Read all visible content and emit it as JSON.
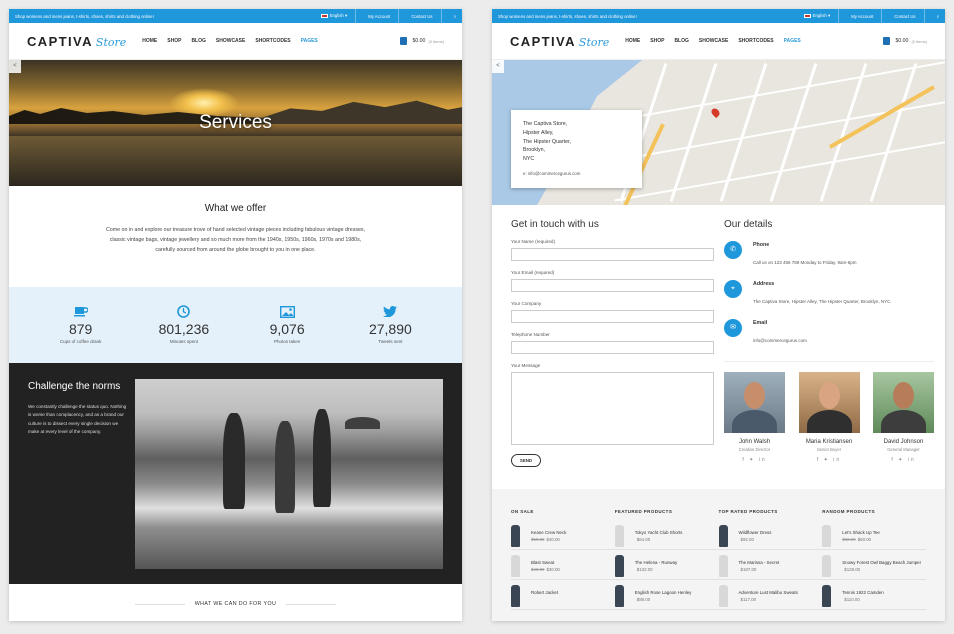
{
  "topbar": {
    "promo": "Shop womens and mens jeans, t-shirts, shoes, shirts and clothing online!",
    "language": "English",
    "account": "My Account",
    "contact": "Contact Us"
  },
  "header": {
    "logo_main": "CAPTIVA",
    "logo_script": "Store",
    "nav": [
      "HOME",
      "SHOP",
      "BLOG",
      "SHOWCASE",
      "SHORTCODES",
      "PAGES"
    ],
    "cart_total": "$0.00",
    "cart_items": "(0 items)"
  },
  "services": {
    "hero_title": "Services",
    "offer_title": "What we offer",
    "offer_text": "Come on in and explore our treasure trove of hand selected vintage pieces including fabulous vintage dresses, classic vintage bags, vintage jewellery and so much more from the 1940s, 1950s, 1960s, 1970s and 1980s, carefully sourced from around the globe brought to you in one place.",
    "stats": [
      {
        "icon": "coffee-icon",
        "value": "879",
        "label": "Cups of coffee drank"
      },
      {
        "icon": "clock-icon",
        "value": "801,236",
        "label": "Minutes spent"
      },
      {
        "icon": "photo-icon",
        "value": "9,076",
        "label": "Photos taken"
      },
      {
        "icon": "twitter-icon",
        "value": "27,890",
        "label": "Tweets sent"
      }
    ],
    "challenge_title": "Challenge the norms",
    "challenge_text": "We constantly challenge the status quo. Nothing is worse than complacency, and as a brand our culture is to dissect every single decision we make at every level of the company.",
    "what_we_can_do": "WHAT WE CAN DO FOR YOU"
  },
  "contact": {
    "address_lines": [
      "The Captiva Store,",
      "Hipster Alley,",
      "The Hipster Quarter,",
      "Brooklyn,",
      "NYC"
    ],
    "address_email": "e: info@commercegurus.com",
    "form_title": "Get in touch with us",
    "fields": [
      "Your Name (required)",
      "Your Email (required)",
      "Your Company",
      "Telephone Number"
    ],
    "message_label": "Your Message",
    "send_label": "SEND",
    "details_title": "Our details",
    "details": [
      {
        "icon": "phone-icon",
        "glyph": "✆",
        "title": "Phone",
        "text": "Call us on 123 456 789 Monday to Friday, 9am-6pm"
      },
      {
        "icon": "location-icon",
        "glyph": "⌖",
        "title": "Address",
        "text": "The Captiva Store, Hipster Alley, The Hipster Quarter, Brooklyn, NYC."
      },
      {
        "icon": "email-icon",
        "glyph": "✉",
        "title": "Email",
        "text": "info@commercegurus.com"
      }
    ],
    "team": [
      {
        "name": "John Walsh",
        "role": "Creative Director"
      },
      {
        "name": "Maria Kristiansen",
        "role": "Senior Buyer"
      },
      {
        "name": "David Johnson",
        "role": "General Manager"
      }
    ],
    "social_glyphs": "f ✦ in"
  },
  "footer": {
    "columns": [
      {
        "title": "ON SALE",
        "products": [
          {
            "name": "Keane Crew Neck",
            "old": "$50.00",
            "price": "$40.00",
            "shade": "dark"
          },
          {
            "name": "Blast Sweat",
            "old": "$40.00",
            "price": "$30.00",
            "shade": "dark"
          },
          {
            "name": "Robert Jacket",
            "old": "",
            "price": "",
            "shade": "dark"
          }
        ]
      },
      {
        "title": "FEATURED PRODUCTS",
        "products": [
          {
            "name": "Tokyo Yacht Club Shorts",
            "old": "",
            "price": "$64.00",
            "shade": "dark"
          },
          {
            "name": "The Helena - Runway",
            "old": "",
            "price": "$132.00",
            "shade": "dark"
          },
          {
            "name": "English Rose Lagoon Henley",
            "old": "",
            "price": "$88.00",
            "shade": "dark"
          }
        ]
      },
      {
        "title": "TOP RATED PRODUCTS",
        "products": [
          {
            "name": "Wildflower Dress",
            "old": "",
            "price": "$92.00",
            "shade": "dark"
          },
          {
            "name": "The Marissa - Secret",
            "old": "",
            "price": "$187.00",
            "shade": "light"
          },
          {
            "name": "Adventure Lust Malibu Sweats",
            "old": "",
            "price": "$117.00",
            "shade": "light"
          }
        ]
      },
      {
        "title": "RANDOM PRODUCTS",
        "products": [
          {
            "name": "Let's Shack Up Tee",
            "old": "$68.00",
            "price": "$60.00",
            "shade": "light"
          },
          {
            "name": "Snowy Forest Owl Baggy Beach Jumper",
            "old": "",
            "price": "$128.00",
            "shade": "light"
          },
          {
            "name": "Tennis 1922 Camden",
            "old": "",
            "price": "$110.00",
            "shade": "dark"
          }
        ]
      }
    ]
  }
}
